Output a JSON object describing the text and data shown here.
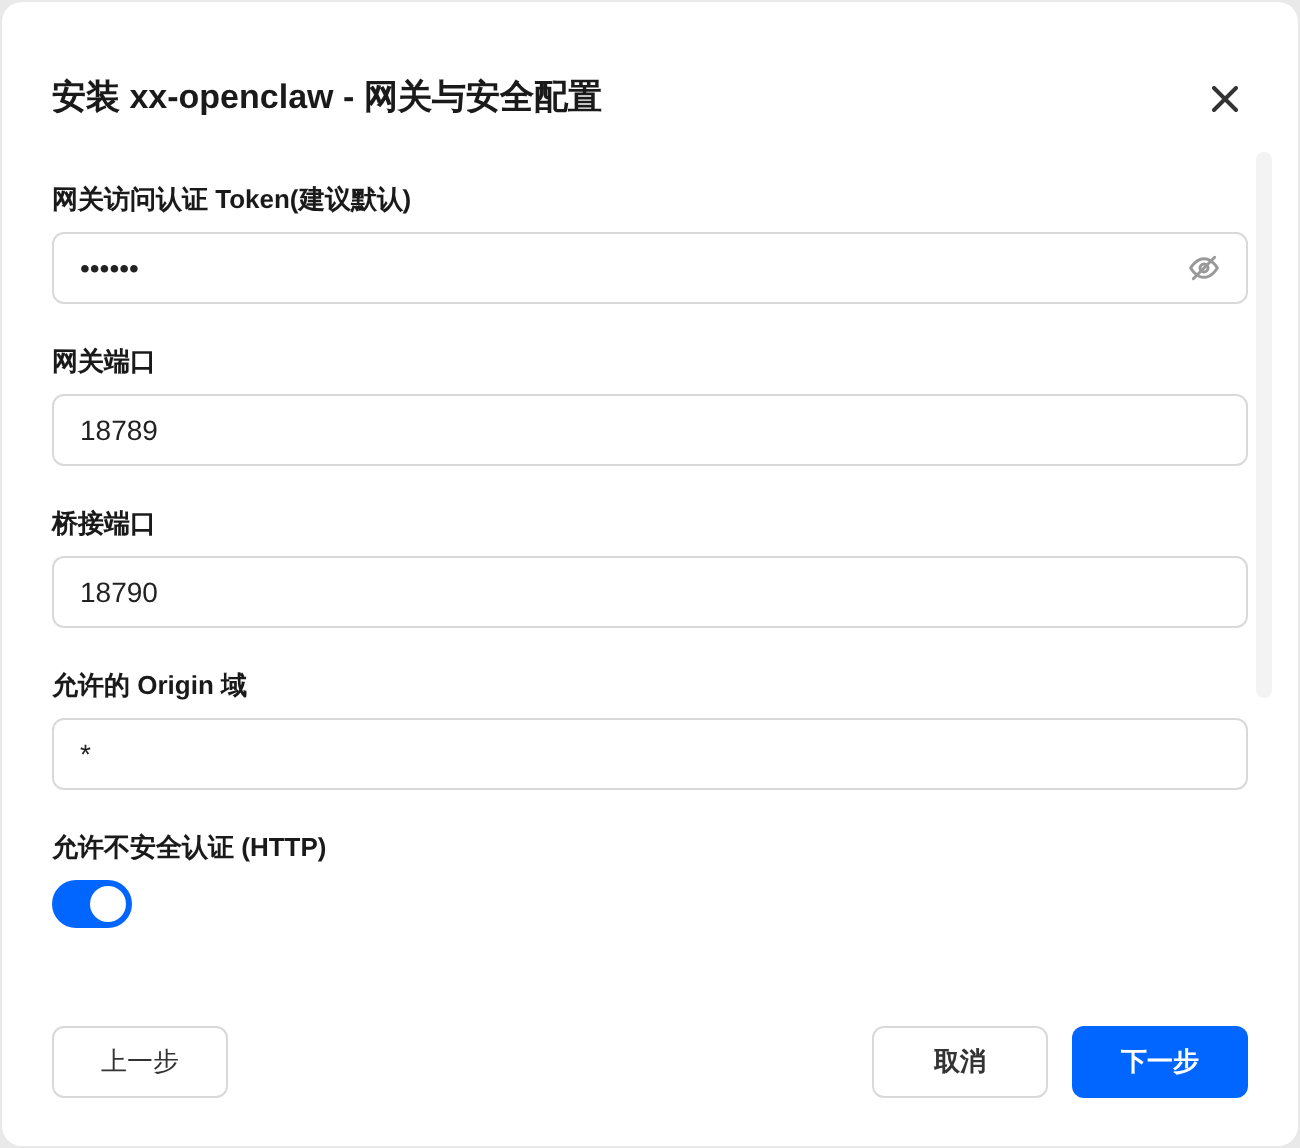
{
  "dialog": {
    "title": "安装 xx-openclaw - 网关与安全配置"
  },
  "fields": [
    {
      "kind": "password",
      "label": "网关访问认证 Token(建议默认)",
      "value": "••••••"
    },
    {
      "kind": "text",
      "label": "网关端口",
      "value": "18789"
    },
    {
      "kind": "text",
      "label": "桥接端口",
      "value": "18790"
    },
    {
      "kind": "text",
      "label": "允许的 Origin 域",
      "value": "*"
    },
    {
      "kind": "toggle",
      "label": "允许不安全认证 (HTTP)",
      "on": true
    }
  ],
  "buttons": {
    "back": "上一步",
    "cancel": "取消",
    "next": "下一步"
  }
}
